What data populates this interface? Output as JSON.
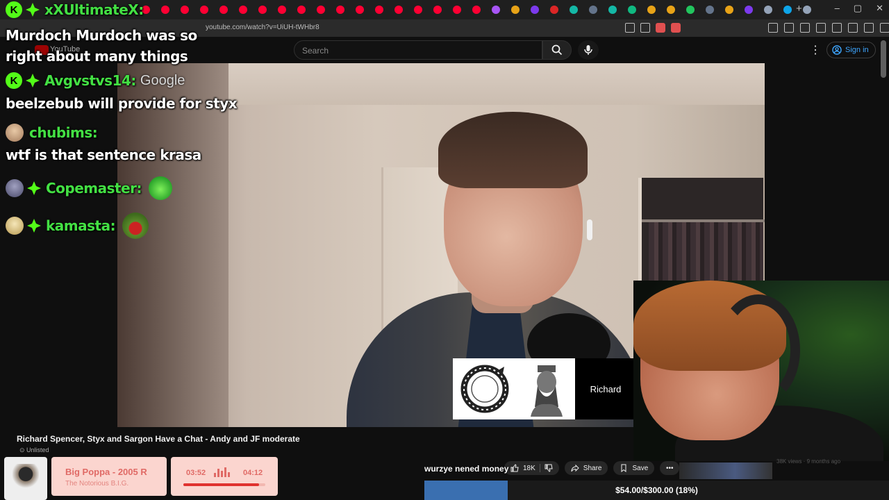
{
  "browser": {
    "url": "youtube.com/watch?v=UiUH-tWHbr8",
    "new_tab_label": "+",
    "window_controls": [
      "–",
      "▢",
      "✕"
    ],
    "tab_icon_colors": [
      "#ff0033",
      "#ff0033",
      "#ff0033",
      "#ff0033",
      "#ff0033",
      "#ff0033",
      "#ff0033",
      "#ff0033",
      "#ff0033",
      "#ff0033",
      "#ff0033",
      "#ff0033",
      "#ff0033",
      "#ff0033",
      "#ff0033",
      "#ff0033",
      "#ff0033",
      "#ff0033",
      "#a855f7",
      "#e8a317",
      "#7c3aed",
      "#dc2626",
      "#14b8a6",
      "#64748b",
      "#14b8a6",
      "#10b981",
      "#e8a317",
      "#e8a317",
      "#22c55e",
      "#64748b",
      "#e8a317",
      "#7c3aed",
      "#94a3b8",
      "#0ea5e9",
      "#94a3b8"
    ]
  },
  "youtube": {
    "search_placeholder": "Search",
    "logo_text": "YouTube",
    "signin_label": "Sign in"
  },
  "chat": [
    {
      "user": "xXUltimateX:",
      "badge": "K",
      "message": "Murdoch Murdoch was so right about many things",
      "user_color": "#43e043"
    },
    {
      "user": "Avgvstvs14:",
      "badge": "K",
      "suffix": "Google",
      "message": "beelzebub will provide for styx",
      "user_color": "#43e043"
    },
    {
      "user": "chubims:",
      "avatar": "avatar-icon",
      "message": "wtf is that sentence krasa",
      "user_color": "#43e043"
    },
    {
      "user": "Copemaster:",
      "emote": "laughing-emote"
    },
    {
      "user": "kamasta:",
      "emote": "screaming-frog-emote"
    }
  ],
  "video": {
    "title": "Richard Spencer, Styx and Sargon Have a Chat - Andy and JF moderate",
    "visibility": "Unlisted",
    "overlay_name": "Richard",
    "like_count": "18K",
    "share_label": "Share",
    "save_label": "Save",
    "views": "38K views · 9 months ago"
  },
  "now_playing": {
    "song": "Big Poppa - 2005 R",
    "artist": "The Notorious B.I.G.",
    "current_time": "03:52",
    "duration": "04:12",
    "progress": 0.92
  },
  "tip": {
    "label": "wurzye nened money",
    "goal_text": "$54.00/$300.00 (18%)",
    "goal_fraction": 0.18
  },
  "colors": {
    "kick_green": "#53fc18",
    "username_green": "#43e043",
    "link_blue": "#3ea6ff",
    "np_pink": "#fbd5cf",
    "np_red": "#e06a66",
    "goal_blue": "#3a6fb0"
  }
}
